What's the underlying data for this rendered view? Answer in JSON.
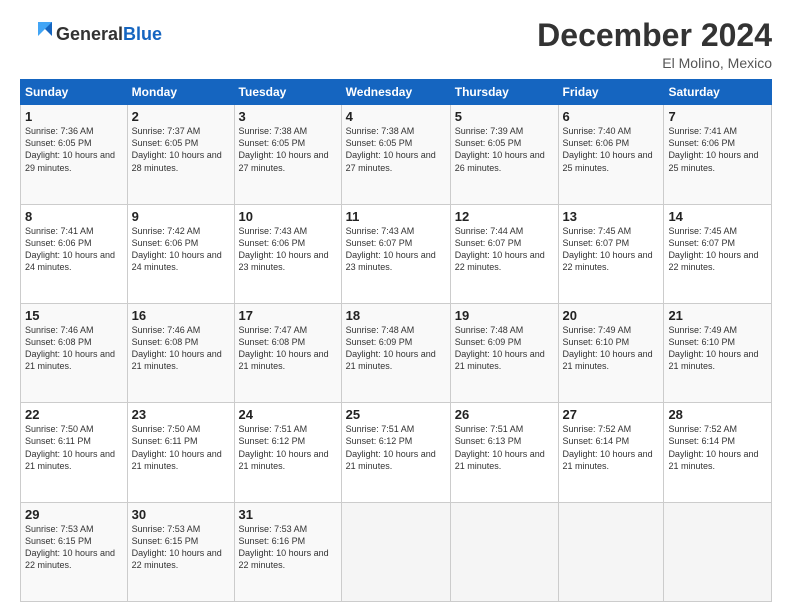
{
  "header": {
    "logo_general": "General",
    "logo_blue": "Blue",
    "month_title": "December 2024",
    "location": "El Molino, Mexico"
  },
  "days_of_week": [
    "Sunday",
    "Monday",
    "Tuesday",
    "Wednesday",
    "Thursday",
    "Friday",
    "Saturday"
  ],
  "weeks": [
    [
      {
        "day": "1",
        "sunrise": "7:36 AM",
        "sunset": "6:05 PM",
        "daylight": "10 hours and 29 minutes."
      },
      {
        "day": "2",
        "sunrise": "7:37 AM",
        "sunset": "6:05 PM",
        "daylight": "10 hours and 28 minutes."
      },
      {
        "day": "3",
        "sunrise": "7:38 AM",
        "sunset": "6:05 PM",
        "daylight": "10 hours and 27 minutes."
      },
      {
        "day": "4",
        "sunrise": "7:38 AM",
        "sunset": "6:05 PM",
        "daylight": "10 hours and 27 minutes."
      },
      {
        "day": "5",
        "sunrise": "7:39 AM",
        "sunset": "6:05 PM",
        "daylight": "10 hours and 26 minutes."
      },
      {
        "day": "6",
        "sunrise": "7:40 AM",
        "sunset": "6:06 PM",
        "daylight": "10 hours and 25 minutes."
      },
      {
        "day": "7",
        "sunrise": "7:41 AM",
        "sunset": "6:06 PM",
        "daylight": "10 hours and 25 minutes."
      }
    ],
    [
      {
        "day": "8",
        "sunrise": "7:41 AM",
        "sunset": "6:06 PM",
        "daylight": "10 hours and 24 minutes."
      },
      {
        "day": "9",
        "sunrise": "7:42 AM",
        "sunset": "6:06 PM",
        "daylight": "10 hours and 24 minutes."
      },
      {
        "day": "10",
        "sunrise": "7:43 AM",
        "sunset": "6:06 PM",
        "daylight": "10 hours and 23 minutes."
      },
      {
        "day": "11",
        "sunrise": "7:43 AM",
        "sunset": "6:07 PM",
        "daylight": "10 hours and 23 minutes."
      },
      {
        "day": "12",
        "sunrise": "7:44 AM",
        "sunset": "6:07 PM",
        "daylight": "10 hours and 22 minutes."
      },
      {
        "day": "13",
        "sunrise": "7:45 AM",
        "sunset": "6:07 PM",
        "daylight": "10 hours and 22 minutes."
      },
      {
        "day": "14",
        "sunrise": "7:45 AM",
        "sunset": "6:07 PM",
        "daylight": "10 hours and 22 minutes."
      }
    ],
    [
      {
        "day": "15",
        "sunrise": "7:46 AM",
        "sunset": "6:08 PM",
        "daylight": "10 hours and 21 minutes."
      },
      {
        "day": "16",
        "sunrise": "7:46 AM",
        "sunset": "6:08 PM",
        "daylight": "10 hours and 21 minutes."
      },
      {
        "day": "17",
        "sunrise": "7:47 AM",
        "sunset": "6:08 PM",
        "daylight": "10 hours and 21 minutes."
      },
      {
        "day": "18",
        "sunrise": "7:48 AM",
        "sunset": "6:09 PM",
        "daylight": "10 hours and 21 minutes."
      },
      {
        "day": "19",
        "sunrise": "7:48 AM",
        "sunset": "6:09 PM",
        "daylight": "10 hours and 21 minutes."
      },
      {
        "day": "20",
        "sunrise": "7:49 AM",
        "sunset": "6:10 PM",
        "daylight": "10 hours and 21 minutes."
      },
      {
        "day": "21",
        "sunrise": "7:49 AM",
        "sunset": "6:10 PM",
        "daylight": "10 hours and 21 minutes."
      }
    ],
    [
      {
        "day": "22",
        "sunrise": "7:50 AM",
        "sunset": "6:11 PM",
        "daylight": "10 hours and 21 minutes."
      },
      {
        "day": "23",
        "sunrise": "7:50 AM",
        "sunset": "6:11 PM",
        "daylight": "10 hours and 21 minutes."
      },
      {
        "day": "24",
        "sunrise": "7:51 AM",
        "sunset": "6:12 PM",
        "daylight": "10 hours and 21 minutes."
      },
      {
        "day": "25",
        "sunrise": "7:51 AM",
        "sunset": "6:12 PM",
        "daylight": "10 hours and 21 minutes."
      },
      {
        "day": "26",
        "sunrise": "7:51 AM",
        "sunset": "6:13 PM",
        "daylight": "10 hours and 21 minutes."
      },
      {
        "day": "27",
        "sunrise": "7:52 AM",
        "sunset": "6:14 PM",
        "daylight": "10 hours and 21 minutes."
      },
      {
        "day": "28",
        "sunrise": "7:52 AM",
        "sunset": "6:14 PM",
        "daylight": "10 hours and 21 minutes."
      }
    ],
    [
      {
        "day": "29",
        "sunrise": "7:53 AM",
        "sunset": "6:15 PM",
        "daylight": "10 hours and 22 minutes."
      },
      {
        "day": "30",
        "sunrise": "7:53 AM",
        "sunset": "6:15 PM",
        "daylight": "10 hours and 22 minutes."
      },
      {
        "day": "31",
        "sunrise": "7:53 AM",
        "sunset": "6:16 PM",
        "daylight": "10 hours and 22 minutes."
      },
      null,
      null,
      null,
      null
    ]
  ]
}
